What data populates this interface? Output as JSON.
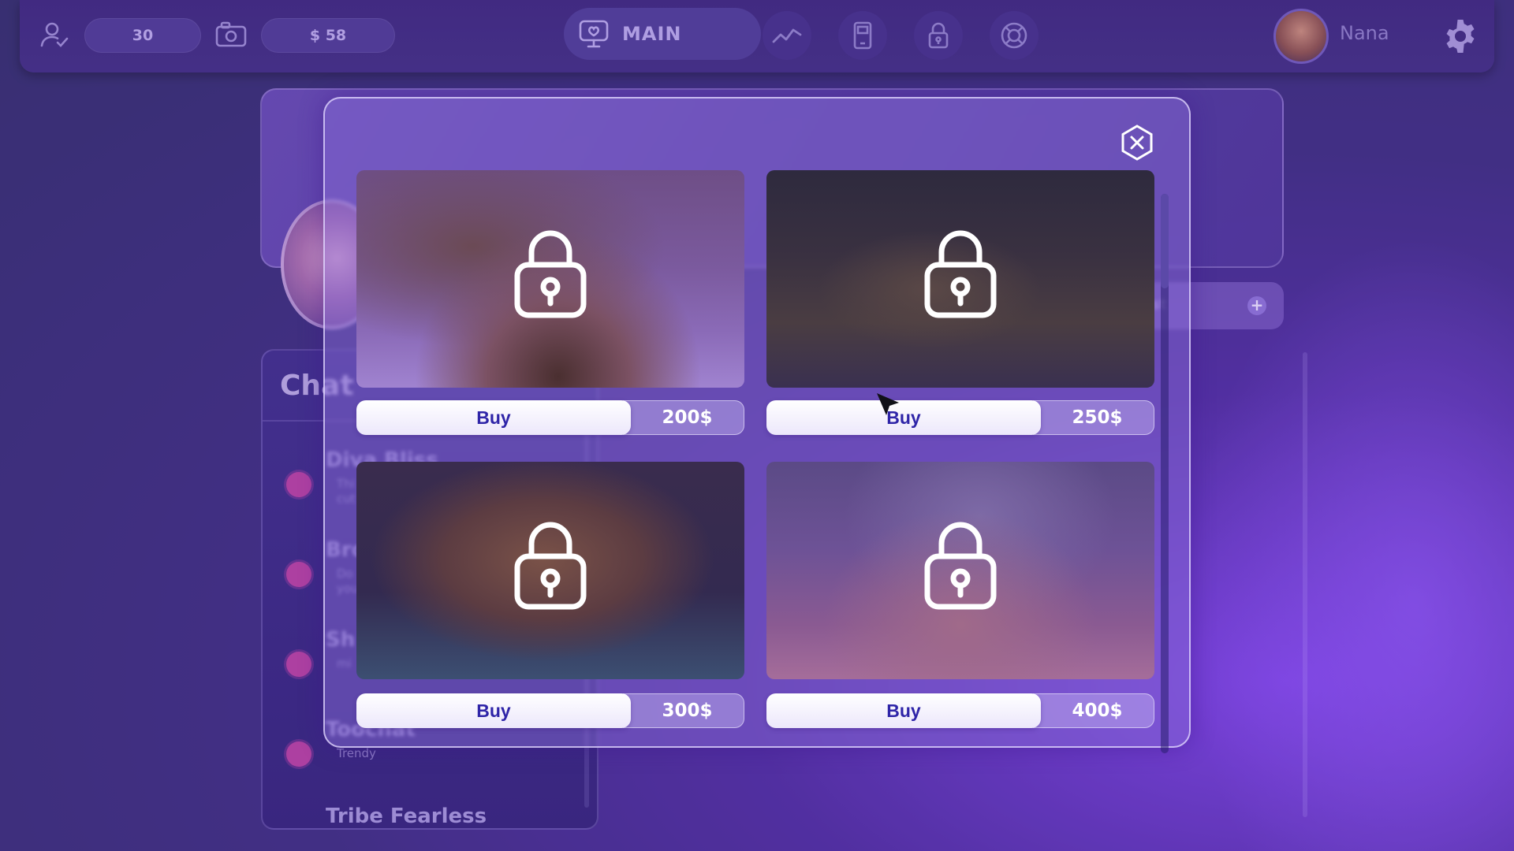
{
  "topbar": {
    "level_value": "30",
    "money_value": "$ 58",
    "main_tab_label": "MAIN",
    "username": "Nana",
    "icons": [
      "user-check-icon",
      "camera-icon",
      "main-screen-icon",
      "stats-icon",
      "phone-icon",
      "lock-icon",
      "lifebuoy-icon",
      "avatar",
      "gear-icon"
    ]
  },
  "background": {
    "chat_title": "Chat",
    "chats": [
      {
        "name": "Diva Bliss",
        "msg1": "Thi",
        "msg2": "cut"
      },
      {
        "name": "Bro",
        "msg1": "Do",
        "msg2": "you"
      },
      {
        "name": "Sh",
        "msg1": "mi",
        "msg2": ""
      },
      {
        "name": "Toochat",
        "msg1": "Trendy",
        "msg2": ""
      },
      {
        "name": "Tribe Fearless",
        "msg1": "",
        "msg2": ""
      }
    ],
    "post_button_text": "st"
  },
  "shop": {
    "items": [
      {
        "buy_label": "Buy",
        "price": "200$",
        "locked": true
      },
      {
        "buy_label": "Buy",
        "price": "250$",
        "locked": true
      },
      {
        "buy_label": "Buy",
        "price": "300$",
        "locked": true
      },
      {
        "buy_label": "Buy",
        "price": "400$",
        "locked": true
      }
    ]
  },
  "colors": {
    "accent": "#3a2478",
    "buy_text": "#2f25a8",
    "chat_dot": "#b43d9c"
  }
}
